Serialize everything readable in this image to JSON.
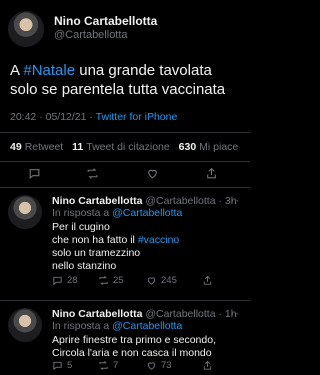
{
  "main_tweet": {
    "author_name": "Nino Cartabellotta",
    "author_handle": "@Cartabellotta",
    "text_prefix": "A ",
    "hashtag": "#Natale",
    "text_suffix": " una grande tavolata solo se parentela tutta vaccinata",
    "timestamp": "20:42 · 05/12/21 · ",
    "source": "Twitter for iPhone",
    "retweets_count": "49",
    "retweets_label": "Retweet",
    "quotes_count": "11",
    "quotes_label": "Tweet di citazione",
    "likes_count": "630",
    "likes_label": "Mi piace"
  },
  "replies": [
    {
      "author_name": "Nino Cartabellotta",
      "author_handle": "@Cartabellotta",
      "time": "· 3h",
      "reply_prefix": "In risposta a ",
      "reply_to": "@Cartabellotta",
      "line1": "Per il cugino",
      "line2_prefix": "che non ha fatto il ",
      "line2_hashtag": "#vaccino",
      "line3": "solo un tramezzino",
      "line4": "nello stanzino",
      "replies_count": "28",
      "retweets_count": "25",
      "likes_count": "245"
    },
    {
      "author_name": "Nino Cartabellotta",
      "author_handle": "@Cartabellotta",
      "time": "· 1h",
      "reply_prefix": "In risposta a ",
      "reply_to": "@Cartabellotta",
      "line1": "Aprire finestre tra primo e secondo,",
      "line2": "Circola l'aria e non casca il mondo",
      "replies_count": "5",
      "retweets_count": "7",
      "likes_count": "73"
    }
  ],
  "icons": {
    "reply": "speech-bubble-icon",
    "retweet": "retweet-icon",
    "like": "heart-icon",
    "share": "share-icon",
    "more": "more-icon"
  },
  "colors": {
    "background": "#000000",
    "accent": "#1d9bf0",
    "muted": "#71767b",
    "divider": "#2f3336"
  }
}
